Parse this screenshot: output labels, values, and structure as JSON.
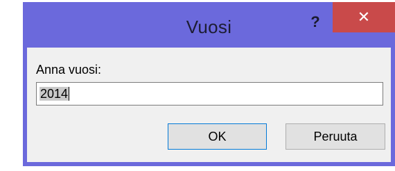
{
  "window": {
    "title": "Vuosi",
    "help_label": "?",
    "close_label": "✕"
  },
  "dialog": {
    "prompt": "Anna vuosi:",
    "input_value": "2014",
    "ok_label": "OK",
    "cancel_label": "Peruuta"
  },
  "colors": {
    "title_bar": "#6b69dc",
    "close_button": "#c94a4a",
    "client_area": "#f0f0f0",
    "ok_border": "#0078d7"
  }
}
